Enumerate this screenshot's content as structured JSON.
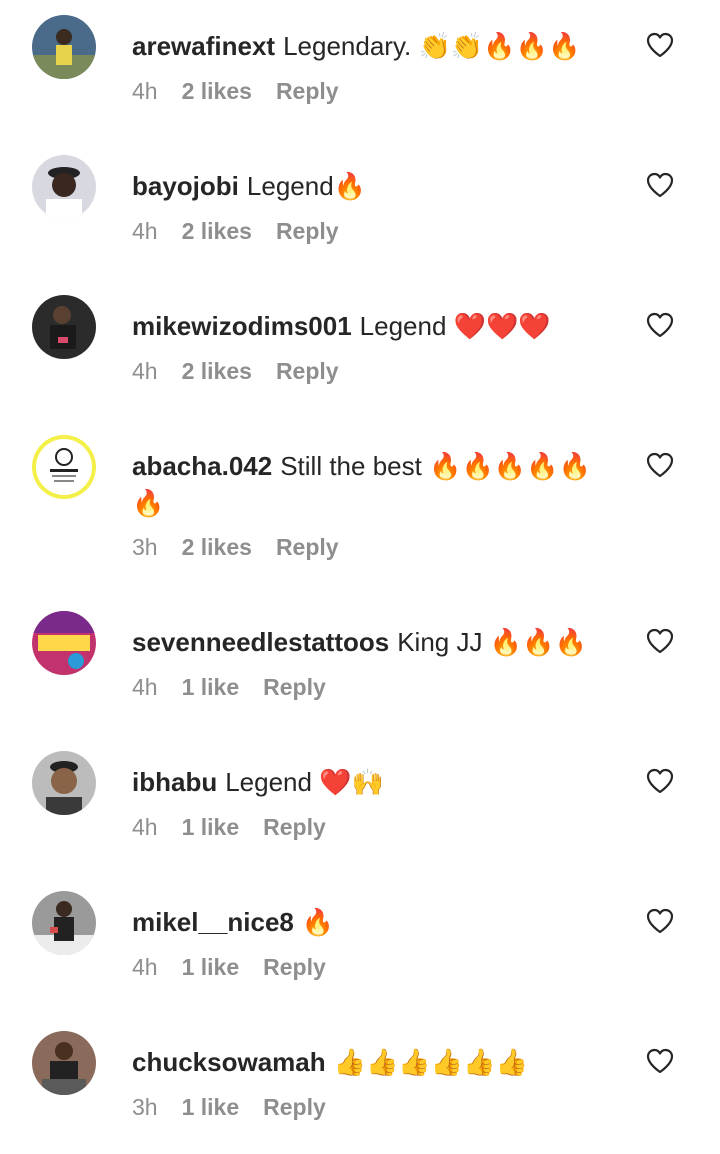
{
  "comments": [
    {
      "username": "arewafinext",
      "text": "Legendary. 👏👏🔥🔥🔥",
      "time": "4h",
      "likes": "2 likes",
      "reply": "Reply",
      "avatar_color": "#4a6a8a"
    },
    {
      "username": "bayojobi",
      "text": "Legend🔥",
      "time": "4h",
      "likes": "2 likes",
      "reply": "Reply",
      "avatar_color": "#c9c9d4"
    },
    {
      "username": "mikewizodims001",
      "text": "Legend ❤️❤️❤️",
      "time": "4h",
      "likes": "2 likes",
      "reply": "Reply",
      "avatar_color": "#2b2b2b"
    },
    {
      "username": "abacha.042",
      "text": "Still the best 🔥🔥🔥🔥🔥🔥",
      "time": "3h",
      "likes": "2 likes",
      "reply": "Reply",
      "avatar_color": "#f3f04a"
    },
    {
      "username": "sevenneedlestattoos",
      "text": "King JJ 🔥🔥🔥",
      "time": "4h",
      "likes": "1 like",
      "reply": "Reply",
      "avatar_color": "#c2336e"
    },
    {
      "username": "ibhabu",
      "text": "Legend ❤️🙌",
      "time": "4h",
      "likes": "1 like",
      "reply": "Reply",
      "avatar_color": "#6d5a4a"
    },
    {
      "username": "mikel__nice8",
      "text": "🔥",
      "time": "4h",
      "likes": "1 like",
      "reply": "Reply",
      "avatar_color": "#8a8a8a"
    },
    {
      "username": "chucksowamah",
      "text": "👍👍👍👍👍👍",
      "time": "3h",
      "likes": "1 like",
      "reply": "Reply",
      "avatar_color": "#6b4a3a"
    }
  ]
}
